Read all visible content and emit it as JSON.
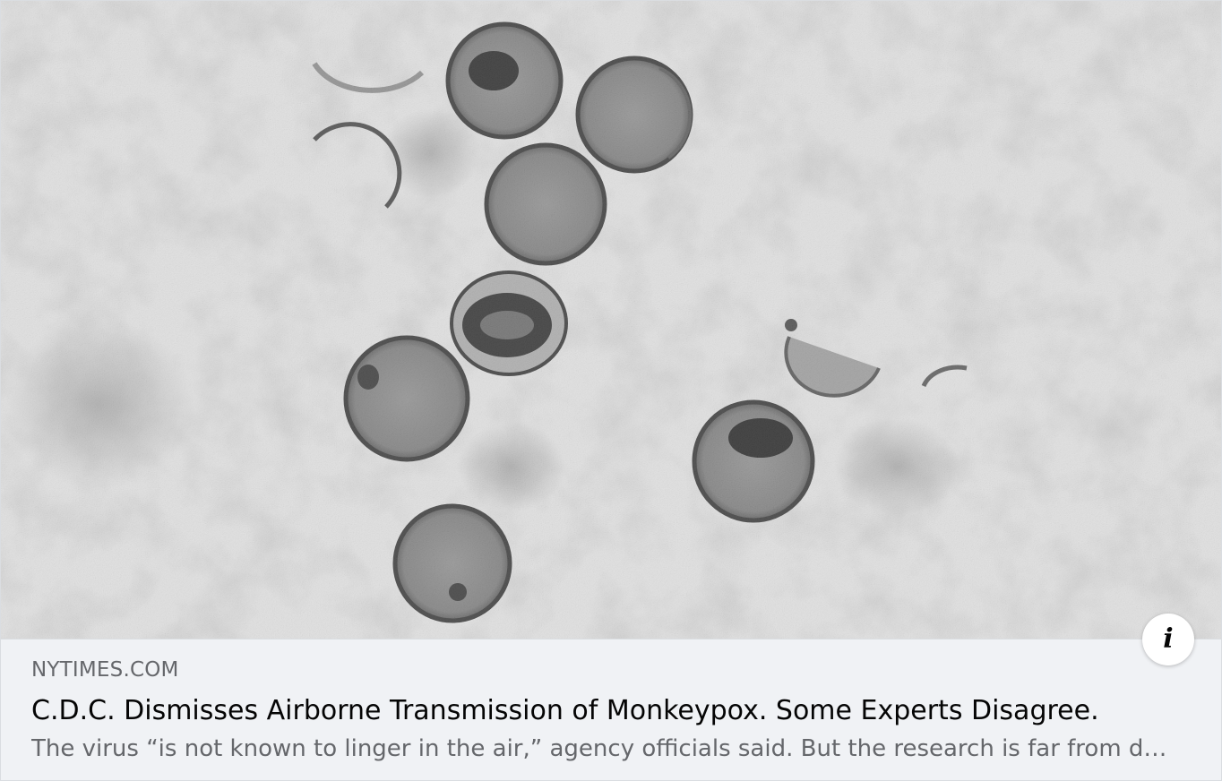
{
  "link_preview": {
    "image_subject": "monkeypox-virions-micrograph",
    "info_icon": "info-icon",
    "source": "NYTIMES.COM",
    "headline": "C.D.C. Dismisses Airborne Transmission of Monkeypox. Some Experts Disagree.",
    "description": "The virus “is not known to linger in the air,” agency officials said. But the research is far from d…"
  },
  "colors": {
    "meta_background": "#f0f2f5",
    "headline_text": "#050505",
    "secondary_text": "#65676b",
    "border": "#dadde1"
  }
}
